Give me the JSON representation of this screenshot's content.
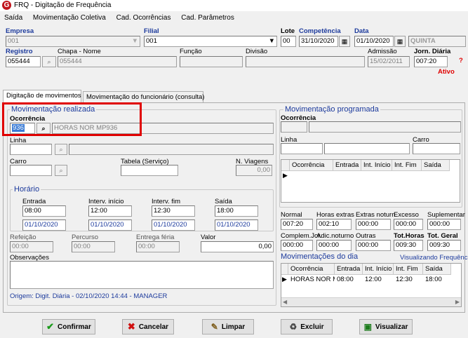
{
  "window": {
    "title": "FRQ - Digitação de Frequência"
  },
  "menu": [
    "Saída",
    "Movimentação Coletiva",
    "Cad. Ocorrências",
    "Cad. Parâmetros"
  ],
  "header": {
    "empresa_label": "Empresa",
    "empresa_value": "001",
    "filial_label": "Filial",
    "filial_value": "001",
    "lote_label": "Lote",
    "lote_value": "00",
    "competencia_label": "Competência",
    "competencia_value": "31/10/2020",
    "data_label": "Data",
    "data_value": "01/10/2020",
    "weekday": "QUINTA",
    "registro_label": "Registro",
    "registro_value": "055444",
    "chapa_nome_label": "Chapa  -  Nome",
    "chapa_value": "055444",
    "funcao_label": "Função",
    "divisao_label": "Divisão",
    "admissao_label": "Admissão",
    "admissao_value": "15/02/2011",
    "jornada_label": "Jorn. Diária",
    "jornada_value": "007:20",
    "status": "Ativo",
    "help": "?"
  },
  "tabs": [
    "Digitação de movimentos",
    "Movimentação do funcionário (consulta)"
  ],
  "left": {
    "group_title": "Movimentação realizada",
    "ocorrencia_label": "Ocorrência",
    "ocorrencia_code": "936",
    "ocorrencia_desc": "HORAS NOR MP936",
    "linha_label": "Linha",
    "carro_label": "Carro",
    "tabela_label": "Tabela (Serviço)",
    "nviagens_label": "N. Viagens",
    "nviagens_value": "0,00",
    "horario_title": "Horário",
    "entrada_label": "Entrada",
    "entrada_time": "08:00",
    "entrada_date": "01/10/2020",
    "interv_ini_label": "Interv. início",
    "interv_ini_time": "12:00",
    "interv_ini_date": "01/10/2020",
    "interv_fim_label": "Interv. fim",
    "interv_fim_time": "12:30",
    "interv_fim_date": "01/10/2020",
    "saida_label": "Saída",
    "saida_time": "18:00",
    "saida_date": "01/10/2020",
    "refeicao_label": "Refeição",
    "refeicao_value": "00:00",
    "percurso_label": "Percurso",
    "percurso_value": "00:00",
    "entrega_label": "Entrega féria",
    "entrega_value": "00:00",
    "valor_label": "Valor",
    "valor_value": "0,00",
    "obs_label": "Observações",
    "origem": "Origem: Digit. Diária - 02/10/2020 14:44 - MANAGER"
  },
  "right": {
    "group_title": "Movimentação programada",
    "ocorrencia_label": "Ocorrência",
    "linha_label": "Linha",
    "carro_label": "Carro",
    "prog_columns": [
      "Ocorrência",
      "Entrada",
      "Int. Início",
      "Int. Fim",
      "Saída"
    ],
    "totals_labels_1": [
      "Normal",
      "Horas extras",
      "Extras noturn",
      "Excesso",
      "Suplementar"
    ],
    "totals_values_1": [
      "007:20",
      "002:10",
      "000:00",
      "000:00",
      "000:00"
    ],
    "totals_labels_2": [
      "Complem.Jor.",
      "Adic.noturno",
      "Outras",
      "Tot.Horas",
      "Tot. Geral"
    ],
    "totals_values_2": [
      "000:00",
      "000:00",
      "000:00",
      "009:30",
      "009:30"
    ],
    "movdia_title": "Movimentações do dia",
    "movdia_link": "Visualizando Frequência",
    "movdia_columns": [
      "Ocorrência",
      "Entrada",
      "Int. Início",
      "Int. Fim",
      "Saída"
    ],
    "movdia_row": [
      "HORAS NOR M",
      "08:00",
      "12:00",
      "12:30",
      "18:00"
    ]
  },
  "buttons": {
    "confirmar": "Confirmar",
    "cancelar": "Cancelar",
    "limpar": "Limpar",
    "excluir": "Excluir",
    "visualizar": "Visualizar"
  },
  "colors": {
    "accent_blue": "#1c3a9c",
    "highlight_red": "#e00000",
    "selection": "#3a7bd5"
  }
}
